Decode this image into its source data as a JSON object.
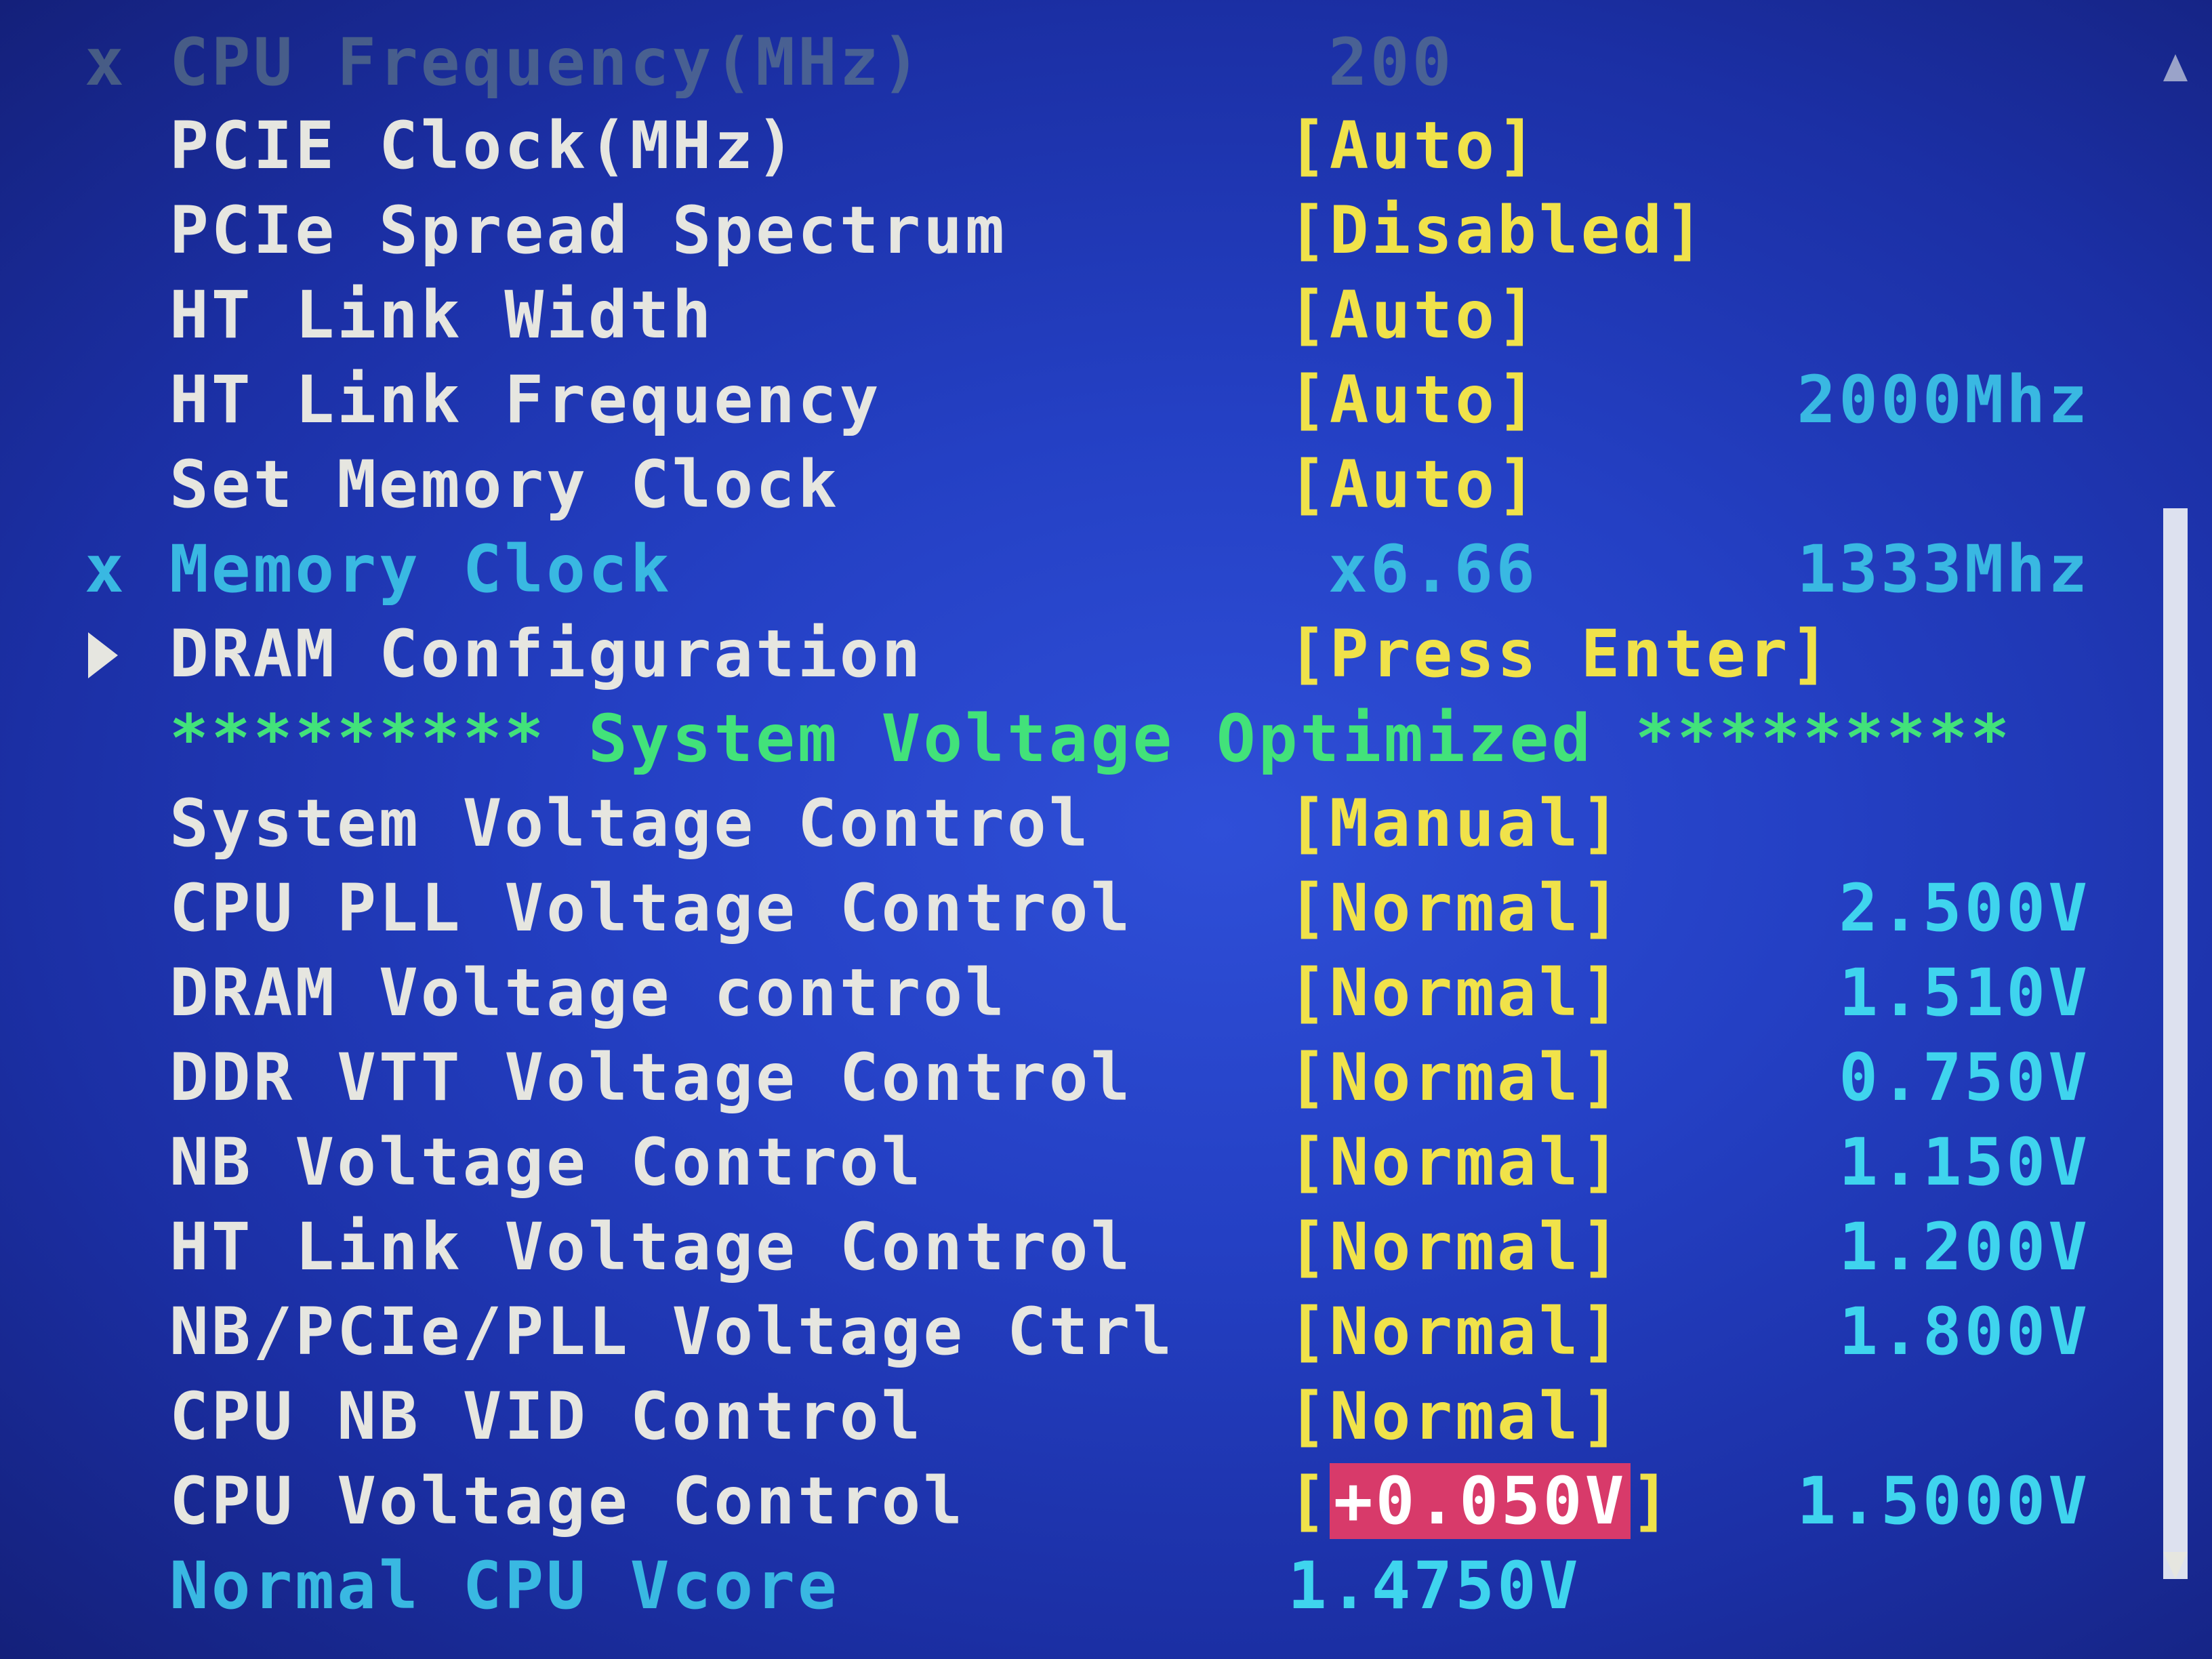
{
  "colors": {
    "background": "#2440c4",
    "label_text": "#e6e6e0",
    "value_text": "#f0e24a",
    "info_text": "#3fd4ee",
    "section_heading": "#42e27a",
    "selection_highlight": "#d83a6a"
  },
  "menu": {
    "rows": [
      {
        "marker": "x",
        "label": "CPU Frequency(MHz)",
        "value": "200",
        "info": ""
      },
      {
        "marker": "",
        "label": "PCIE Clock(MHz)",
        "value": "[Auto]",
        "info": ""
      },
      {
        "marker": "",
        "label": "PCIe Spread Spectrum",
        "value": "[Disabled]",
        "info": ""
      },
      {
        "marker": "",
        "label": "HT Link Width",
        "value": "[Auto]",
        "info": ""
      },
      {
        "marker": "",
        "label": "HT Link Frequency",
        "value": "[Auto]",
        "info": "2000Mhz"
      },
      {
        "marker": "",
        "label": "Set Memory Clock",
        "value": "[Auto]",
        "info": ""
      },
      {
        "marker": "x",
        "label": "Memory Clock",
        "value": "x6.66",
        "info": "1333Mhz"
      },
      {
        "marker": "submenu-arrow-icon",
        "label": "DRAM Configuration",
        "value": "[Press Enter]",
        "info": ""
      },
      {
        "section_heading": "********* System Voltage Optimized *********"
      },
      {
        "marker": "",
        "label": "System Voltage Control",
        "value": "[Manual]",
        "info": ""
      },
      {
        "marker": "",
        "label": "CPU PLL Voltage Control",
        "value": "[Normal]",
        "info": "2.500V"
      },
      {
        "marker": "",
        "label": "DRAM Voltage control",
        "value": "[Normal]",
        "info": "1.510V"
      },
      {
        "marker": "",
        "label": "DDR VTT Voltage Control",
        "value": "[Normal]",
        "info": "0.750V"
      },
      {
        "marker": "",
        "label": "NB Voltage Control",
        "value": "[Normal]",
        "info": "1.150V"
      },
      {
        "marker": "",
        "label": "HT Link Voltage Control",
        "value": "[Normal]",
        "info": "1.200V"
      },
      {
        "marker": "",
        "label": "NB/PCIe/PLL Voltage Ctrl",
        "value": "[Normal]",
        "info": "1.800V"
      },
      {
        "marker": "",
        "label": "CPU NB VID Control",
        "value": "[Normal]",
        "info": ""
      },
      {
        "marker": "",
        "label": "CPU Voltage Control",
        "value_open": "[",
        "value_selected": "+0.050V",
        "value_close": "]",
        "info": "1.5000V"
      },
      {
        "marker": "",
        "label": "Normal CPU Vcore",
        "value": "1.4750V",
        "info": ""
      }
    ]
  },
  "scrollbar": {
    "up_icon": "scroll-up-arrow-icon",
    "down_icon": "scroll-down-arrow-icon"
  }
}
